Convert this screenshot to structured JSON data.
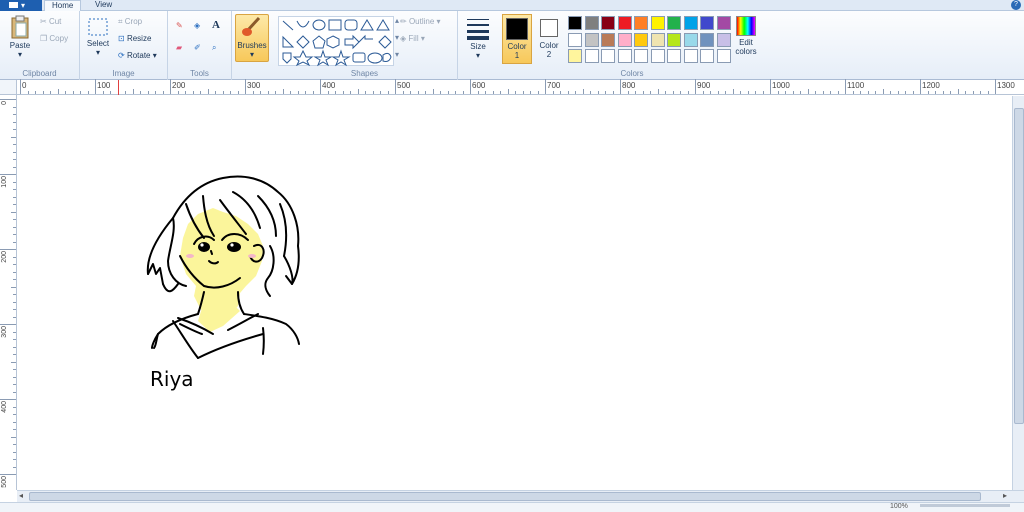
{
  "tabs": {
    "file_label": "",
    "home": "Home",
    "view": "View",
    "help": "?"
  },
  "clipboard": {
    "paste": "Paste",
    "cut": "Cut",
    "copy": "Copy",
    "group": "Clipboard"
  },
  "image": {
    "select": "Select",
    "crop": "Crop",
    "resize": "Resize",
    "rotate": "Rotate",
    "group": "Image"
  },
  "tools": {
    "group": "Tools",
    "text_tool": "A"
  },
  "brushes": {
    "label": "Brushes"
  },
  "shapes": {
    "group": "Shapes",
    "outline": "Outline",
    "fill": "Fill"
  },
  "size": {
    "label": "Size"
  },
  "colors": {
    "color1_line1": "Color",
    "color1_line2": "1",
    "color2_line1": "Color",
    "color2_line2": "2",
    "edit_line1": "Edit",
    "edit_line2": "colors",
    "group": "Colors",
    "color1": "#000000",
    "color2": "#ffffff",
    "palette": [
      "#000000",
      "#7f7f7f",
      "#880015",
      "#ed1c24",
      "#ff7f27",
      "#fff200",
      "#22b14c",
      "#00a2e8",
      "#3f48cc",
      "#a349a4",
      "#ffffff",
      "#c3c3c3",
      "#b97a57",
      "#ffaec9",
      "#ffc90e",
      "#efe4b0",
      "#b5e61d",
      "#99d9ea",
      "#7092be",
      "#c8bfe7",
      "#fff59d",
      "#ffffff",
      "#ffffff",
      "#ffffff",
      "#ffffff",
      "#ffffff",
      "#ffffff",
      "#ffffff",
      "#ffffff",
      "#ffffff"
    ]
  },
  "ruler": {
    "h_labels": [
      "0",
      "100",
      "200",
      "300",
      "400",
      "500",
      "600",
      "700",
      "800",
      "900",
      "1000",
      "1100",
      "1200",
      "1300"
    ],
    "v_labels": [
      "0",
      "100",
      "200",
      "300",
      "400",
      "500"
    ]
  },
  "drawing": {
    "signature": "Riya",
    "hair_color": "#000000",
    "skin_color": "#fbf59b",
    "blush_color": "#f4b7c8"
  },
  "statusbar": {
    "zoom": "100%"
  }
}
